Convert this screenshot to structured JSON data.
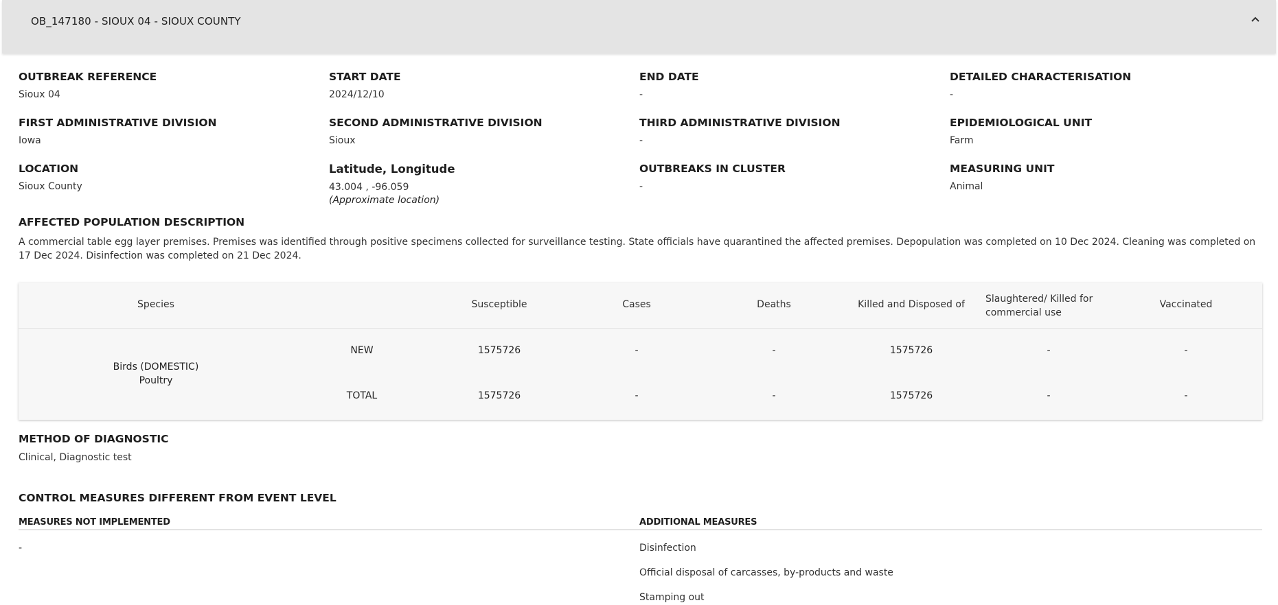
{
  "header": {
    "title": "OB_147180 - SIOUX 04 - SIOUX COUNTY",
    "chevron_icon": "chevron-up-icon"
  },
  "fields": {
    "outbreak_reference": {
      "label": "OUTBREAK REFERENCE",
      "value": "Sioux 04"
    },
    "start_date": {
      "label": "START DATE",
      "value": "2024/12/10"
    },
    "end_date": {
      "label": "END DATE",
      "value": "-"
    },
    "detailed_characterisation": {
      "label": "DETAILED CHARACTERISATION",
      "value": "-"
    },
    "first_admin": {
      "label": "FIRST ADMINISTRATIVE DIVISION",
      "value": "Iowa"
    },
    "second_admin": {
      "label": "SECOND ADMINISTRATIVE DIVISION",
      "value": "Sioux"
    },
    "third_admin": {
      "label": "THIRD ADMINISTRATIVE DIVISION",
      "value": "-"
    },
    "epi_unit": {
      "label": "EPIDEMIOLOGICAL UNIT",
      "value": "Farm"
    },
    "location": {
      "label": "LOCATION",
      "value": "Sioux County"
    },
    "lat_long": {
      "label": "Latitude, Longitude",
      "value": "43.004 , -96.059",
      "note": "(Approximate location)"
    },
    "outbreaks_in_cluster": {
      "label": "OUTBREAKS IN CLUSTER",
      "value": "-"
    },
    "measuring_unit": {
      "label": "MEASURING UNIT",
      "value": "Animal"
    }
  },
  "affected_population": {
    "label": "AFFECTED POPULATION DESCRIPTION",
    "text": "A commercial table egg layer premises. Premises was identified through positive specimens collected for surveillance testing. State officials have quarantined the affected premises. Depopulation was completed on 10 Dec 2024. Cleaning was completed on 17 Dec 2024. Disinfection was completed on 21 Dec 2024."
  },
  "table": {
    "headers": {
      "species": "Species",
      "susceptible": "Susceptible",
      "cases": "Cases",
      "deaths": "Deaths",
      "killed": "Killed and Disposed of",
      "slaughtered_line1": "Slaughtered/ Killed for",
      "slaughtered_line2": "commercial use",
      "vaccinated": "Vaccinated"
    },
    "species_line1": "Birds (DOMESTIC)",
    "species_line2": "Poultry",
    "rows": [
      {
        "type": "NEW",
        "susceptible": "1575726",
        "cases": "-",
        "deaths": "-",
        "killed": "1575726",
        "slaughtered": "-",
        "vaccinated": "-"
      },
      {
        "type": "TOTAL",
        "susceptible": "1575726",
        "cases": "-",
        "deaths": "-",
        "killed": "1575726",
        "slaughtered": "-",
        "vaccinated": "-"
      }
    ]
  },
  "diagnostic": {
    "label": "METHOD OF DIAGNOSTIC",
    "value": "Clinical, Diagnostic test"
  },
  "control_measures": {
    "title": "CONTROL MEASURES DIFFERENT FROM EVENT LEVEL",
    "not_implemented": {
      "label": "MEASURES NOT IMPLEMENTED",
      "items": [
        "-"
      ]
    },
    "additional": {
      "label": "ADDITIONAL MEASURES",
      "items": [
        "Disinfection",
        "Official disposal of carcasses, by-products and waste",
        "Stamping out"
      ]
    }
  }
}
